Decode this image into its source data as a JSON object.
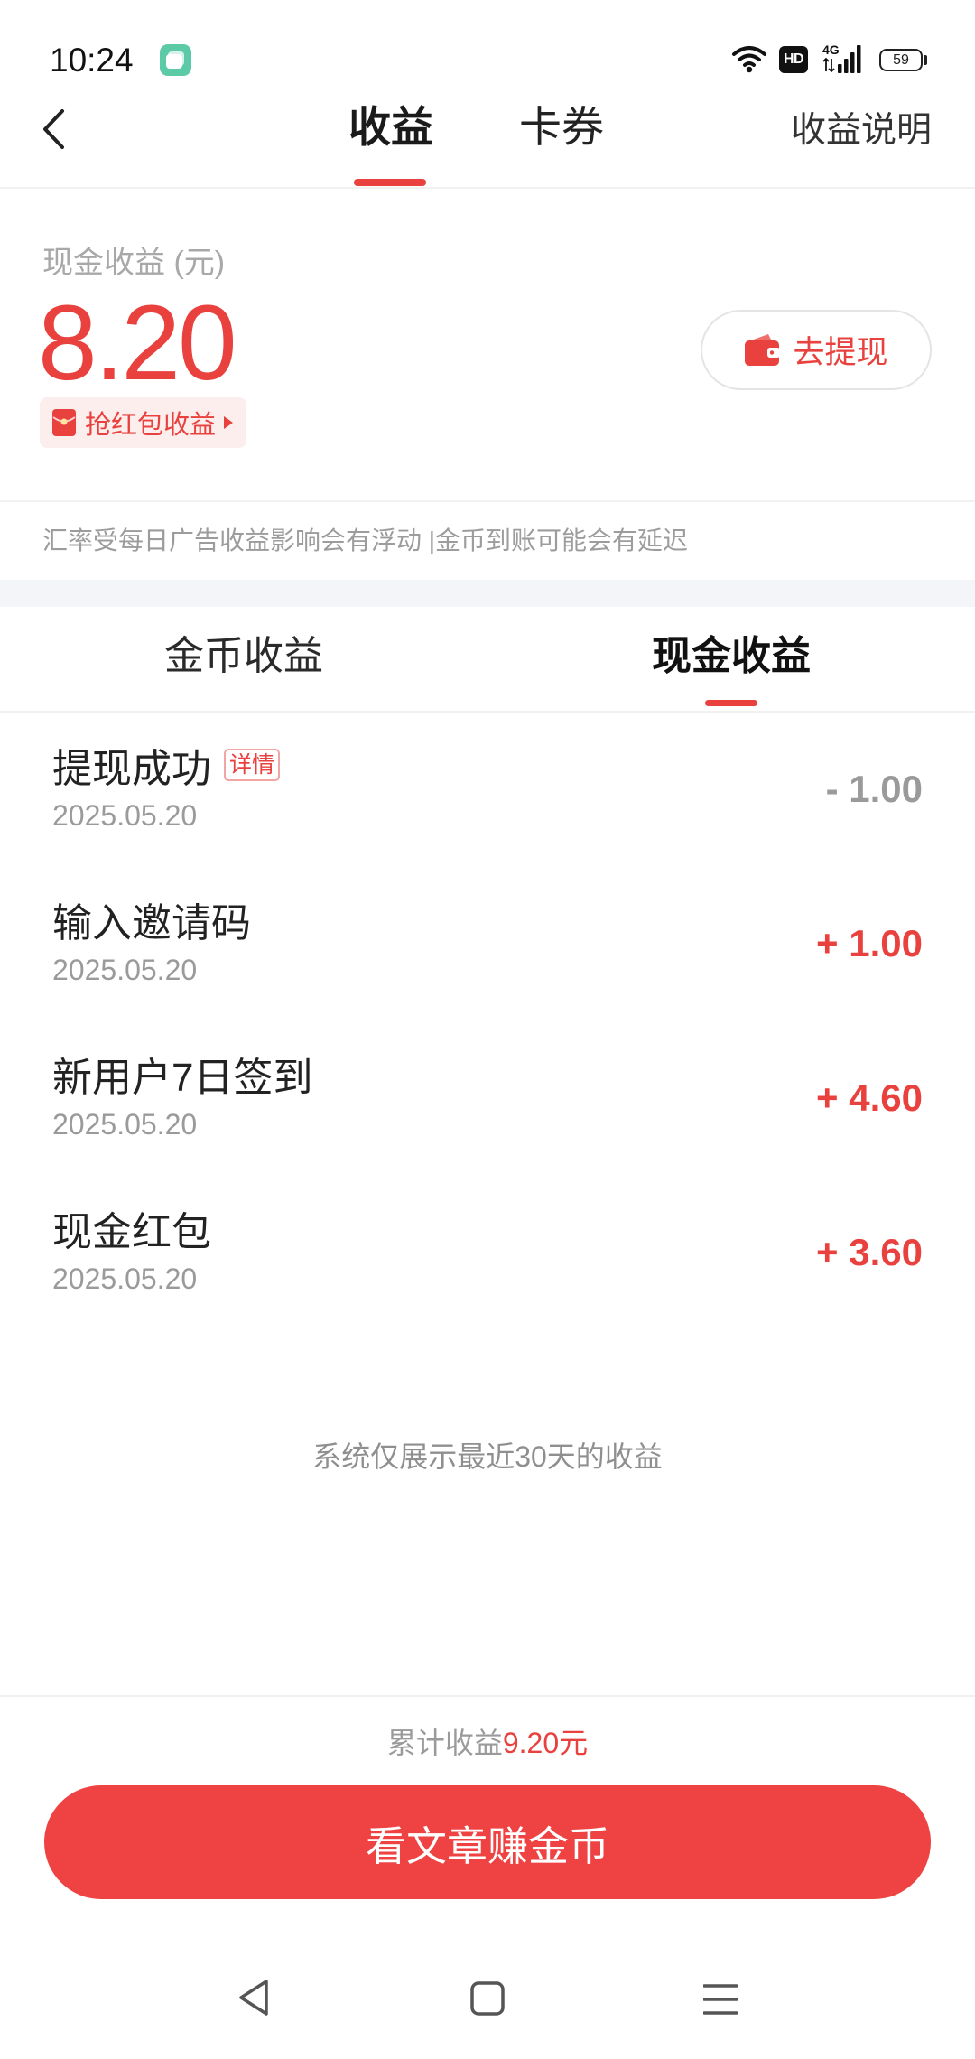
{
  "status_bar": {
    "time": "10:24",
    "hd_label": "HD",
    "network_label": "4G",
    "battery_level": "59",
    "icons": [
      "app-notification-icon",
      "wifi-icon",
      "hd-icon",
      "signal-icon",
      "battery-icon"
    ]
  },
  "header": {
    "back_icon": "chevron-left-icon",
    "tabs": [
      {
        "label": "收益",
        "active": true
      },
      {
        "label": "卡券",
        "active": false
      }
    ],
    "help_link": "收益说明"
  },
  "balance": {
    "label": "现金收益 (元)",
    "amount": "8.20",
    "red_packet_badge": {
      "icon": "red-envelope-icon",
      "label": "抢红包收益",
      "arrow_icon": "triangle-right-icon"
    },
    "withdraw_button": {
      "icon": "wallet-icon",
      "label": "去提现"
    }
  },
  "notice": "汇率受每日广告收益影响会有浮动 |金币到账可能会有延迟",
  "income_tabs": [
    {
      "label": "金币收益",
      "active": false
    },
    {
      "label": "现金收益",
      "active": true
    }
  ],
  "records": [
    {
      "title": "提现成功",
      "tag": "详情",
      "date": "2025.05.20",
      "amount": "- 1.00",
      "direction": "out"
    },
    {
      "title": "输入邀请码",
      "date": "2025.05.20",
      "amount": "+ 1.00",
      "direction": "in"
    },
    {
      "title": "新用户7日签到",
      "date": "2025.05.20",
      "amount": "+ 4.60",
      "direction": "in"
    },
    {
      "title": "现金红包",
      "date": "2025.05.20",
      "amount": "+ 3.60",
      "direction": "in"
    }
  ],
  "footer_note": "系统仅展示最近30天的收益",
  "total": {
    "label": "累计收益",
    "value": "9.20元"
  },
  "cta_label": "看文章赚金币",
  "nav_bar": {
    "icons": [
      "back-triangle-icon",
      "home-square-icon",
      "menu-lines-icon"
    ]
  },
  "colors": {
    "accent": "#e8413e",
    "button": "#ef4242",
    "text_primary": "#222222",
    "text_secondary": "#9a9a9a",
    "badge_bg": "#fdeeee",
    "section_band": "#f4f5f8",
    "app_icon": "#5ccaa6"
  }
}
